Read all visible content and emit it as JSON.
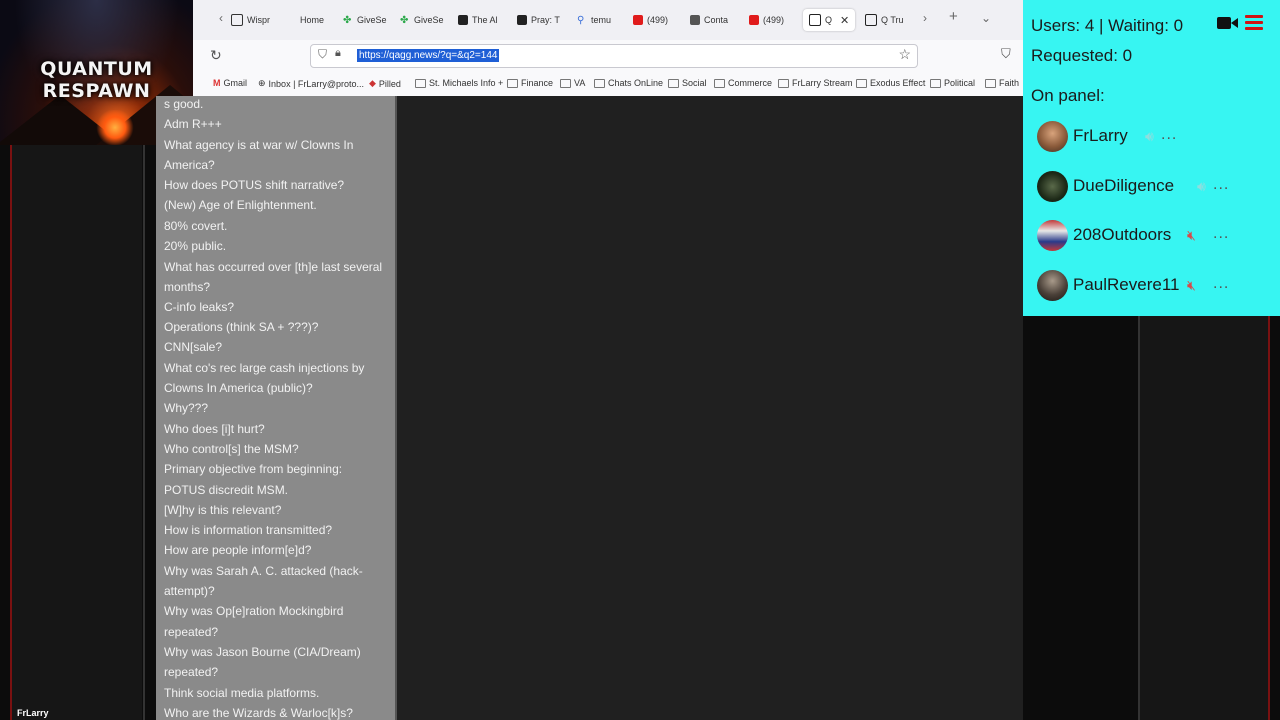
{
  "overlay": {
    "title_logo": "QUANTUM RESPAWN",
    "users_line": "Users: 4 | Waiting: 0",
    "requested_line": "Requested: 0",
    "on_panel_label": "On panel:",
    "panel_members": [
      {
        "name": "FrLarry",
        "mic": "on",
        "more": "..."
      },
      {
        "name": "DueDiligence",
        "mic": "on",
        "more": "..."
      },
      {
        "name": "208Outdoors",
        "mic": "muted",
        "more": "..."
      },
      {
        "name": "PaulRevere11",
        "mic": "muted",
        "more": "..."
      }
    ],
    "accent_color": "#37f5f2",
    "icons": [
      "camera-icon",
      "menu-icon"
    ]
  },
  "browser": {
    "tabs": [
      {
        "label": "Wispr",
        "icon": "page-icon"
      },
      {
        "label": "Home",
        "icon": ""
      },
      {
        "label": "GiveSe",
        "icon": "givesend-icon"
      },
      {
        "label": "GiveSe",
        "icon": "givesend-icon"
      },
      {
        "label": "The Al",
        "icon": "p-icon"
      },
      {
        "label": "Pray: T",
        "icon": "p-icon"
      },
      {
        "label": "temu",
        "icon": "search-icon"
      },
      {
        "label": "(499)",
        "icon": "youtube-icon"
      },
      {
        "label": "Conta",
        "icon": "contacts-icon"
      },
      {
        "label": "(499)",
        "icon": "youtube-icon"
      },
      {
        "label": "Q",
        "icon": "truth-icon",
        "active": true
      },
      {
        "label": "Q Tru",
        "icon": "truth-icon"
      }
    ],
    "url": "https://qagg.news/?q=&q2=144",
    "bookmarks": [
      {
        "label": "Gmail",
        "icon": "gmail-icon"
      },
      {
        "label": "Inbox | FrLarry@proto...",
        "icon": "globe-icon"
      },
      {
        "label": "Pilled",
        "icon": "pill-icon"
      },
      {
        "label": "St. Michaels Info +",
        "icon": "folder-icon"
      },
      {
        "label": "Finance",
        "icon": "folder-icon"
      },
      {
        "label": "VA",
        "icon": "folder-icon"
      },
      {
        "label": "Chats OnLine",
        "icon": "folder-icon"
      },
      {
        "label": "Social",
        "icon": "folder-icon"
      },
      {
        "label": "Commerce",
        "icon": "folder-icon"
      },
      {
        "label": "FrLarry Stream",
        "icon": "folder-icon"
      },
      {
        "label": "Exodus Effect",
        "icon": "folder-icon"
      },
      {
        "label": "Political",
        "icon": "folder-icon"
      },
      {
        "label": "Faith",
        "icon": "folder-icon"
      }
    ],
    "page_lines": [
      "s good.",
      "Adm R+++",
      "What agency is at war w/ Clowns In",
      "America?",
      "How does POTUS shift narrative?",
      "(New) Age of Enlightenment.",
      "80% covert.",
      "20% public.",
      "What has occurred over [th]e last several",
      "months?",
      "C-info leaks?",
      "Operations (think SA + ???)?",
      "CNN[sale?",
      "What co's rec large cash injections by",
      "Clowns In America (public)?",
      "Why???",
      "Who does [i]t hurt?",
      "Who control[s] the MSM?",
      "Primary objective from beginning:",
      "POTUS discredit MSM.",
      "[W]hy is this relevant?",
      "How is information transmitted?",
      "How are people inform[e]d?",
      "Why was Sarah A. C. attacked (hack-",
      "attempt)?",
      "Why was Op[e]ration Mockingbird",
      "repeated?",
      "Why was Jason Bourne (CIA/Dream)",
      "repeated?",
      "Think social media platforms.",
      "Who are the Wizards & Warloc[k]s?"
    ]
  },
  "stream": {
    "bottom_name": "FrLarry"
  }
}
